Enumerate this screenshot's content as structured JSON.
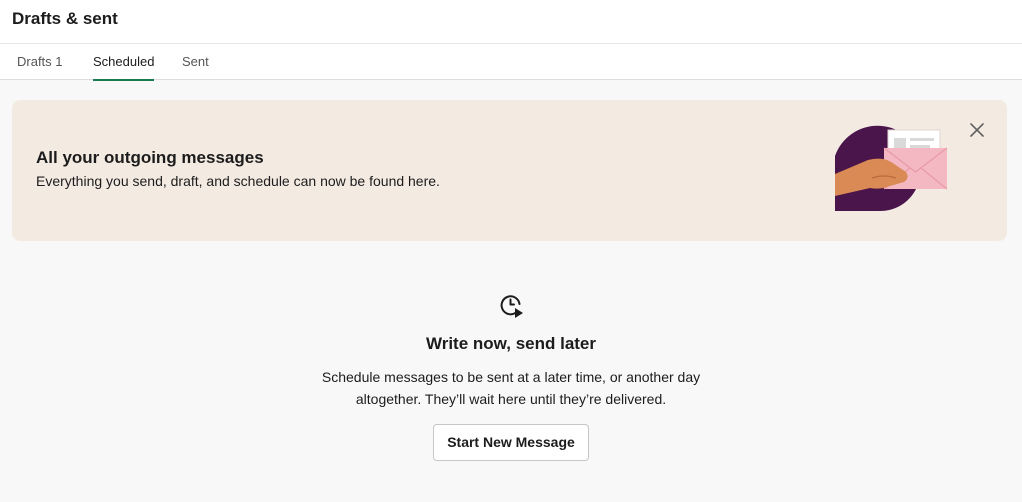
{
  "header": {
    "title": "Drafts & sent"
  },
  "tabs": [
    {
      "label": "Drafts 1"
    },
    {
      "label": "Scheduled",
      "active": true
    },
    {
      "label": "Sent"
    }
  ],
  "banner": {
    "title": "All your outgoing messages",
    "text": "Everything you send, draft, and schedule can now be found here.",
    "illustration": "hand-holding-envelope-illustration",
    "close_icon": "close-icon"
  },
  "empty_state": {
    "icon": "clock-send-icon",
    "title": "Write now, send later",
    "description": "Schedule messages to be sent at a later time, or another day altogether. They’ll wait here until they’re delivered.",
    "button_label": "Start New Message"
  },
  "colors": {
    "accent": "#1a7a52",
    "banner_bg": "#f3ebe2",
    "aubergine": "#4a154b",
    "envelope_pink": "#f4b8c2",
    "page_bg": "#f8f8f8"
  }
}
